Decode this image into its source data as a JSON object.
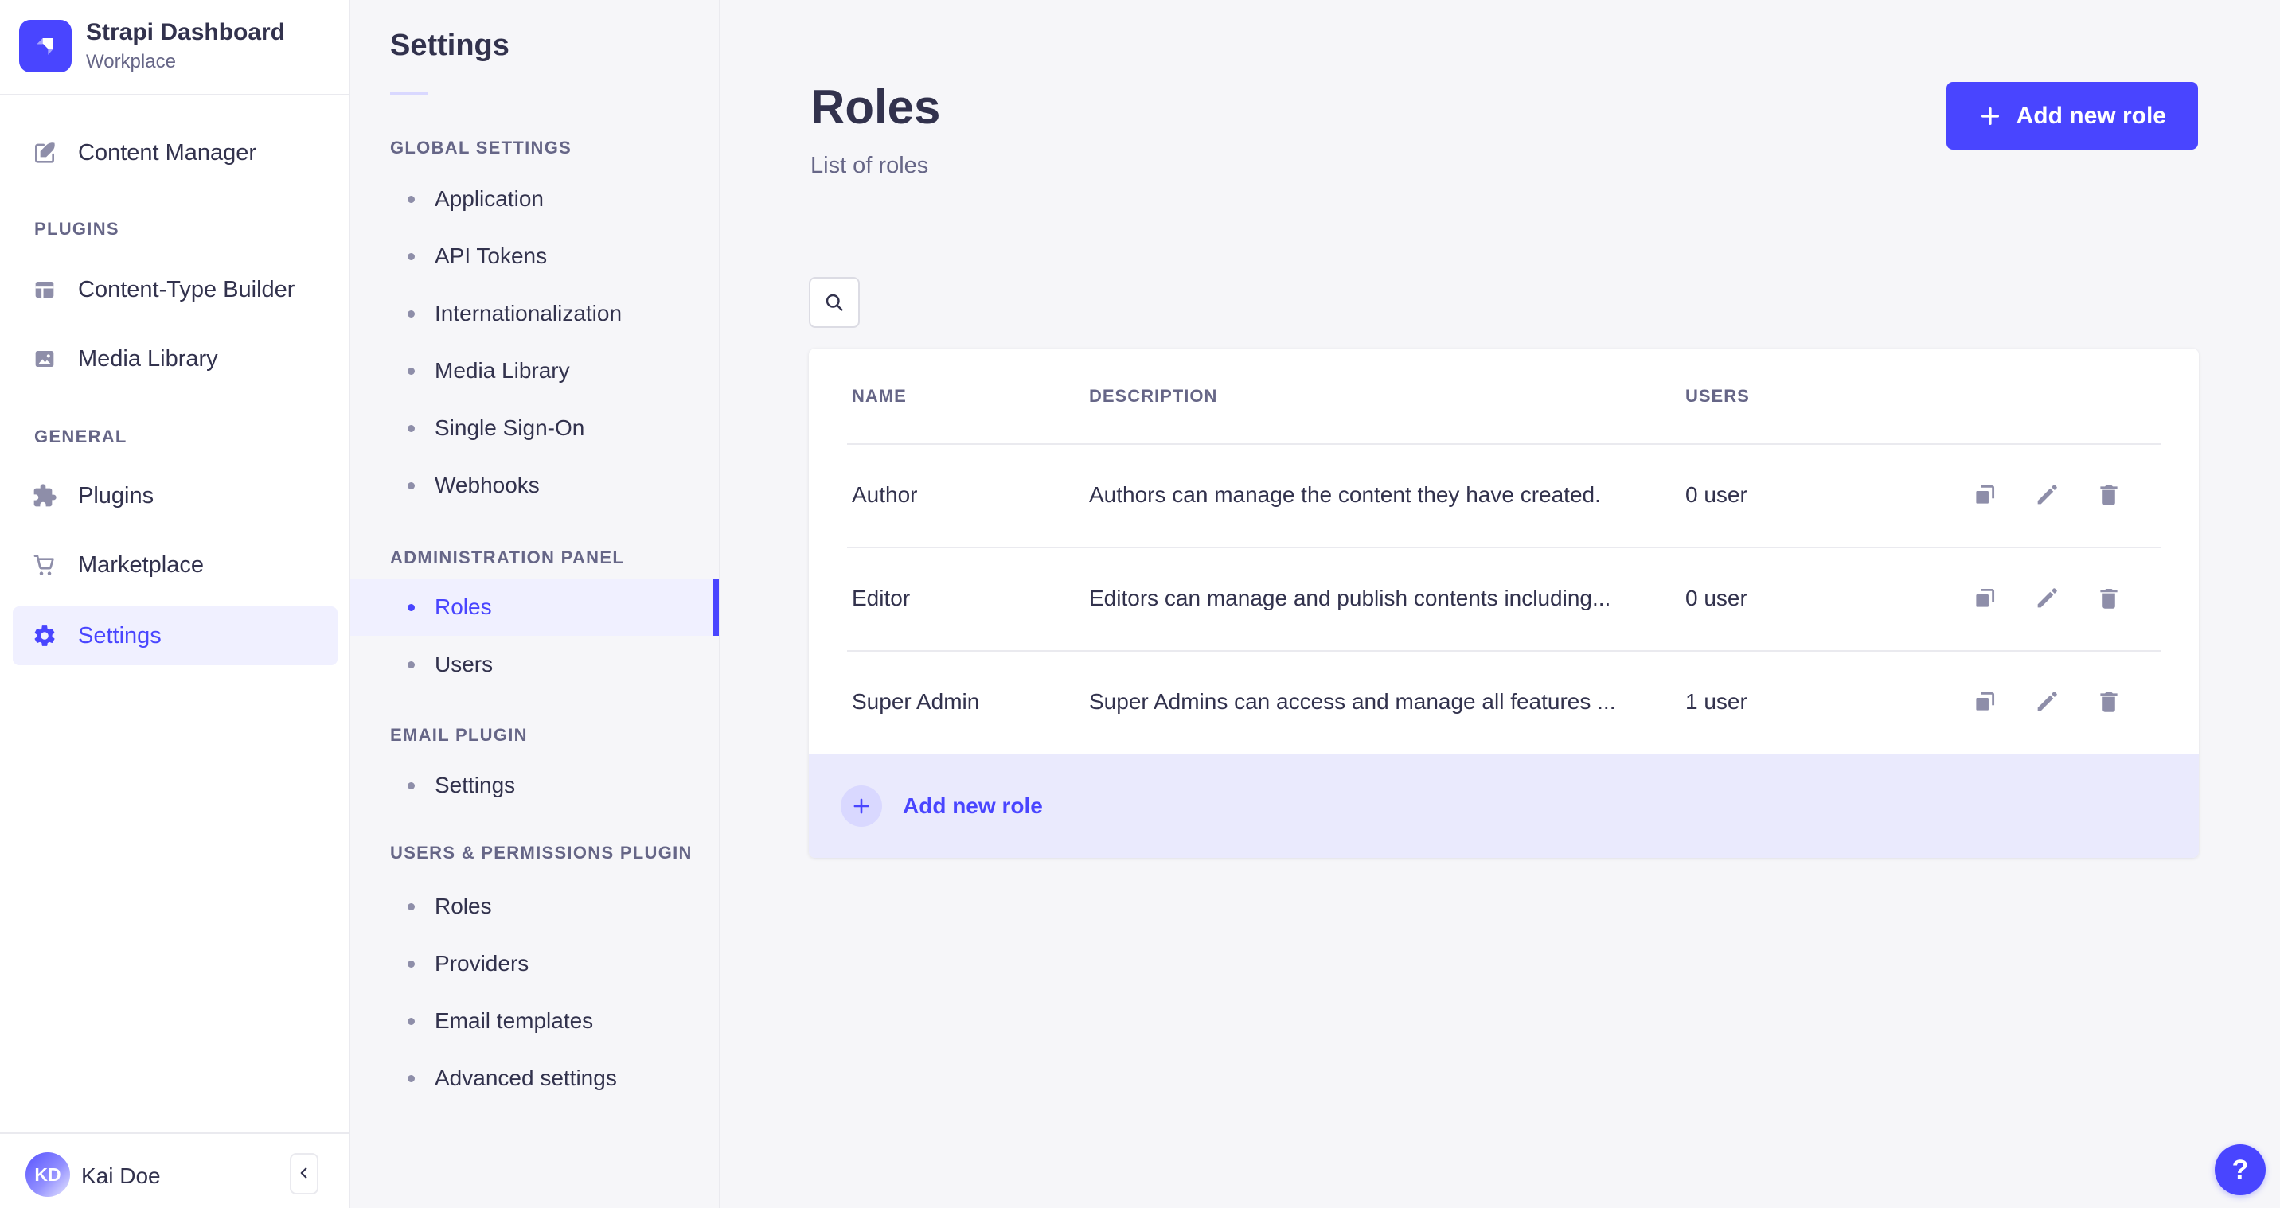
{
  "app": {
    "name": "Strapi Dashboard",
    "workspace": "Workplace"
  },
  "sidebar": {
    "content_manager": "Content Manager",
    "sections": [
      {
        "label": "PLUGINS",
        "items": [
          {
            "label": "Content-Type Builder",
            "icon": "layout-grid-icon"
          },
          {
            "label": "Media Library",
            "icon": "image-icon"
          }
        ]
      },
      {
        "label": "GENERAL",
        "items": [
          {
            "label": "Plugins",
            "icon": "puzzle-icon"
          },
          {
            "label": "Marketplace",
            "icon": "cart-icon"
          },
          {
            "label": "Settings",
            "icon": "gear-icon",
            "active": true
          }
        ]
      }
    ],
    "user": {
      "initials": "KD",
      "name": "Kai Doe"
    }
  },
  "settings_nav": {
    "title": "Settings",
    "sections": [
      {
        "label": "GLOBAL SETTINGS",
        "items": [
          {
            "label": "Application"
          },
          {
            "label": "API Tokens"
          },
          {
            "label": "Internationalization"
          },
          {
            "label": "Media Library"
          },
          {
            "label": "Single Sign-On"
          },
          {
            "label": "Webhooks"
          }
        ]
      },
      {
        "label": "ADMINISTRATION PANEL",
        "items": [
          {
            "label": "Roles",
            "active": true
          },
          {
            "label": "Users"
          }
        ]
      },
      {
        "label": "EMAIL PLUGIN",
        "items": [
          {
            "label": "Settings"
          }
        ]
      },
      {
        "label": "USERS & PERMISSIONS PLUGIN",
        "items": [
          {
            "label": "Roles"
          },
          {
            "label": "Providers"
          },
          {
            "label": "Email templates"
          },
          {
            "label": "Advanced settings"
          }
        ]
      }
    ]
  },
  "main": {
    "page_title": "Roles",
    "page_subtitle": "List of roles",
    "add_new_role_button": "Add new role",
    "table": {
      "columns": {
        "name": "NAME",
        "description": "DESCRIPTION",
        "users": "USERS"
      },
      "rows": [
        {
          "name": "Author",
          "description": "Authors can manage the content they have created.",
          "users": "0 user"
        },
        {
          "name": "Editor",
          "description": "Editors can manage and publish contents including...",
          "users": "0 user"
        },
        {
          "name": "Super Admin",
          "description": "Super Admins can access and manage all features ...",
          "users": "1 user"
        }
      ],
      "footer_add_label": "Add new role"
    },
    "help_label": "?"
  },
  "icons": {
    "logo": "strapi-logo",
    "content_manager": "feather-square-icon",
    "search": "magnifier-icon",
    "duplicate": "copy-icon",
    "edit": "pencil-icon",
    "delete": "trash-icon",
    "add": "plus-icon",
    "collapse": "chevron-left-icon",
    "help": "question-mark-icon"
  },
  "colors": {
    "accent": "#4945ff",
    "accent_soft": "#f0f0ff",
    "accent_soft2": "#d9d8ff",
    "footer_bg": "#eaeafd",
    "text": "#32324d",
    "muted": "#666687",
    "icon_gray": "#8e8ea9",
    "border": "#eaeaef",
    "page_bg": "#f6f6f9",
    "card_bg": "#ffffff"
  }
}
